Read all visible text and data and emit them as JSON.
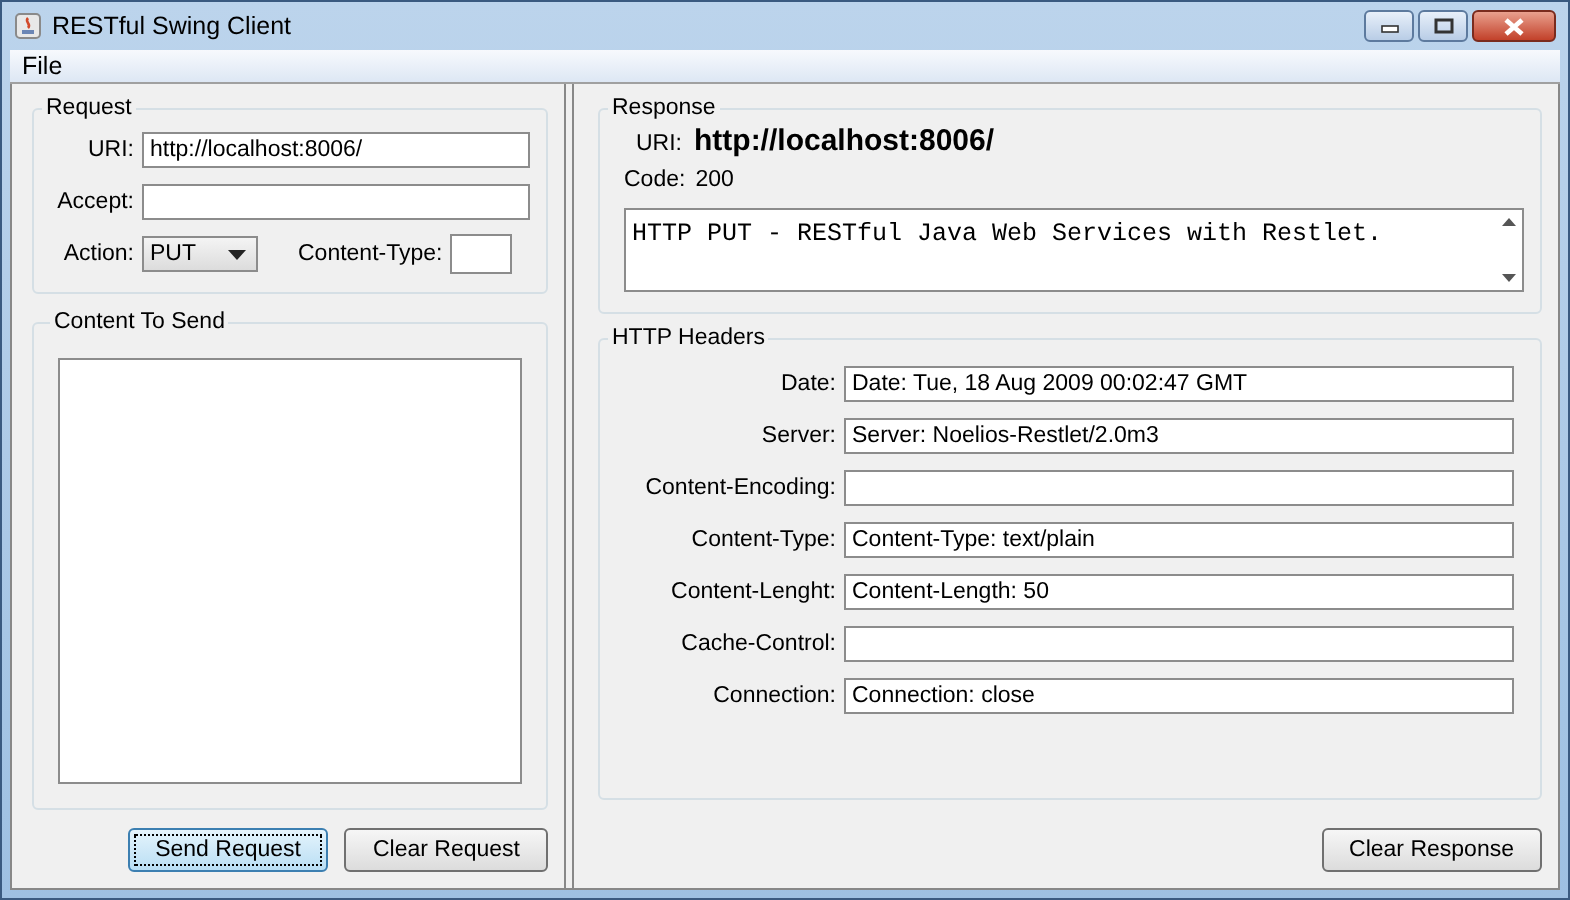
{
  "window": {
    "title": "RESTful Swing Client",
    "controls": [
      {
        "kind": "minimize"
      },
      {
        "kind": "maximize"
      },
      {
        "kind": "close"
      }
    ]
  },
  "menu": [
    "File"
  ],
  "request": {
    "title": "Request",
    "uri_label": "URI:",
    "uri": "http://localhost:8006/",
    "accept_label": "Accept:",
    "action_label": "Action:",
    "action": "PUT",
    "content_type_label": "Content-Type:"
  },
  "content": {
    "title": "Content To Send"
  },
  "request_buttons": [
    {
      "label": "Send Request",
      "focused": true
    },
    {
      "label": "Clear Request",
      "focused": false
    }
  ],
  "response": {
    "title": "Response",
    "uri_label": "URI:",
    "uri": "http://localhost:8006/",
    "code_label": "Code:",
    "code": "200",
    "body": "HTTP PUT - RESTful Java Web Services with Restlet."
  },
  "headers": {
    "title": "HTTP Headers",
    "rows": [
      {
        "label": "Date:",
        "value": "Date: Tue, 18 Aug 2009 00:02:47 GMT"
      },
      {
        "label": "Server:",
        "value": "Server: Noelios-Restlet/2.0m3"
      },
      {
        "label": "Content-Encoding:"
      },
      {
        "label": "Content-Type:",
        "value": "Content-Type: text/plain"
      },
      {
        "label": "Content-Lenght:",
        "value": "Content-Length: 50"
      },
      {
        "label": "Cache-Control:"
      },
      {
        "label": "Connection:",
        "value": "Connection: close"
      }
    ]
  },
  "response_buttons": [
    {
      "label": "Clear Response",
      "focused": false
    }
  ]
}
